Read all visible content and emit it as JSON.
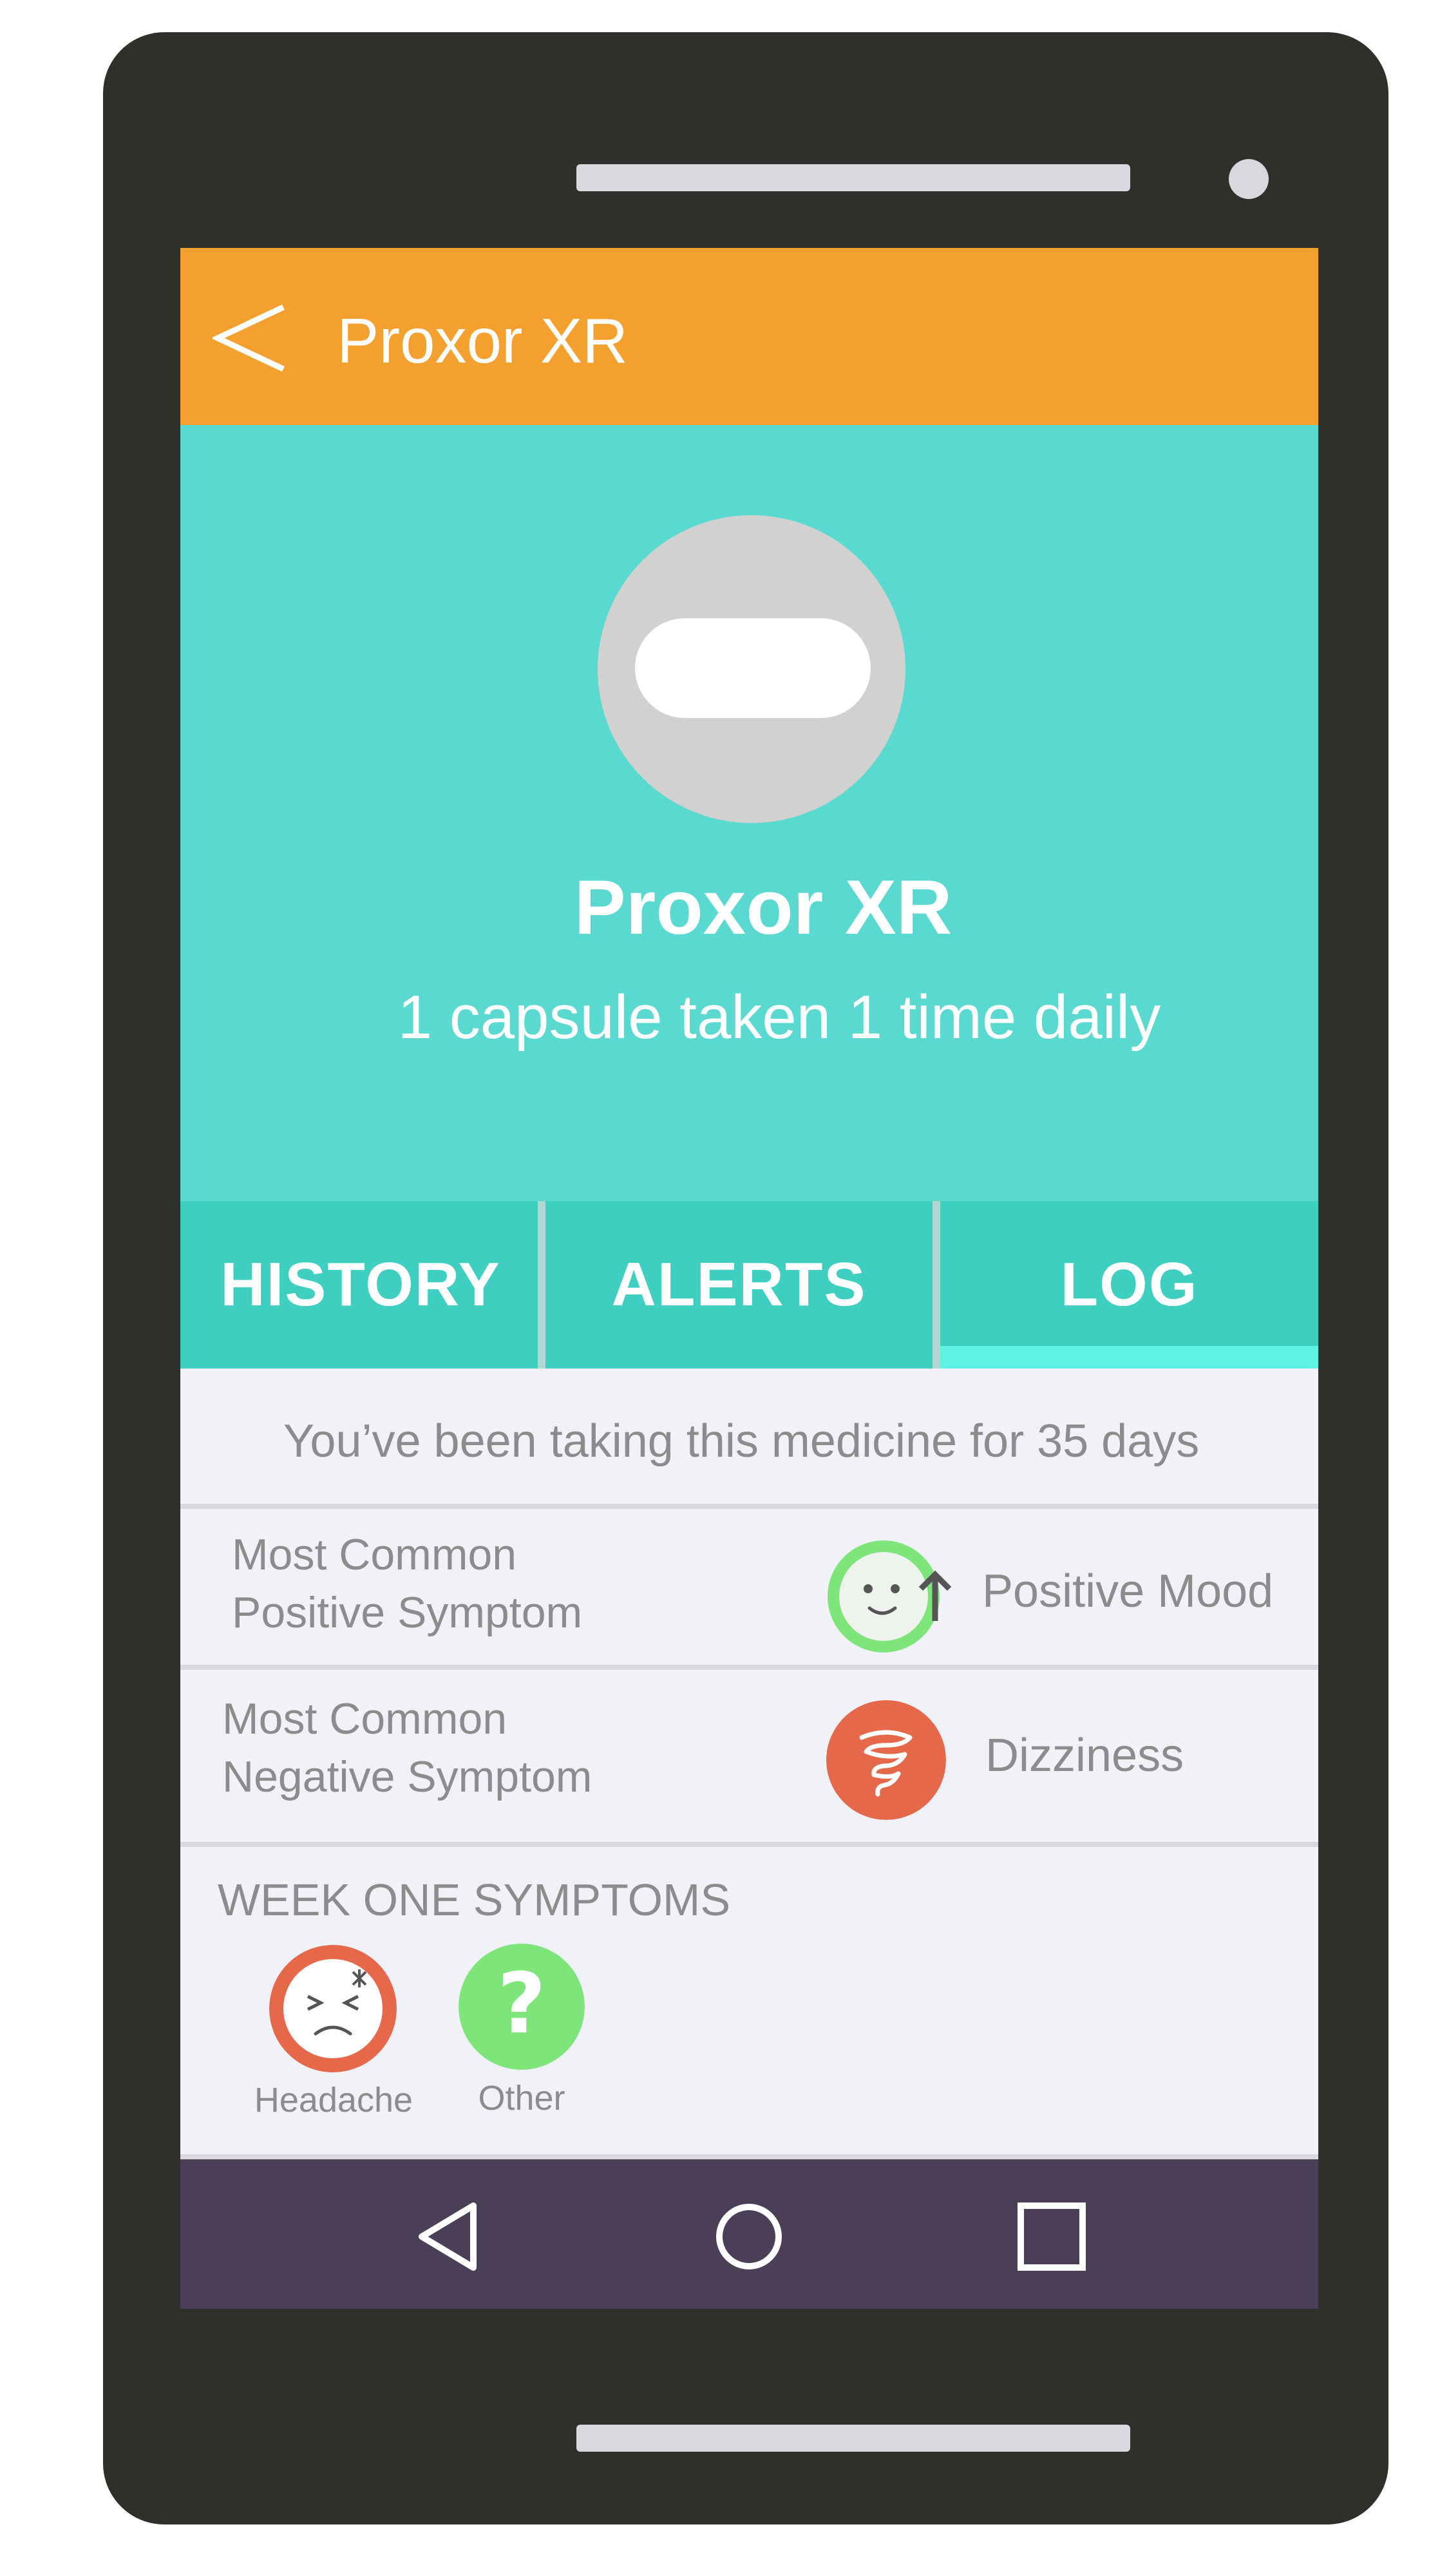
{
  "app": {
    "title": "Proxor XR"
  },
  "hero": {
    "name": "Proxor XR",
    "dose": "1 capsule taken 1 time daily"
  },
  "tabs": [
    {
      "label": "HISTORY",
      "active": false
    },
    {
      "label": "ALERTS",
      "active": false
    },
    {
      "label": "LOG",
      "active": true
    }
  ],
  "log": {
    "duration_text": "You’ve been taking this medicine for 35 days",
    "positive": {
      "label_line1": "Most Common",
      "label_line2": "Positive Symptom",
      "symptom": "Positive Mood",
      "icon": "smiley-mood-up-icon"
    },
    "negative": {
      "label_line1": "Most Common",
      "label_line2": "Negative Symptom",
      "symptom": "Dizziness",
      "icon": "dizziness-swirl-icon"
    },
    "week_one": {
      "heading": "WEEK ONE SYMPTOMS",
      "items": [
        {
          "label": "Headache",
          "icon": "headache-face-icon"
        },
        {
          "label": "Other",
          "icon": "question-mark-icon"
        }
      ]
    }
  },
  "colors": {
    "app_bar": "#f4a02e",
    "hero": "#5ad9d1",
    "tabs": "#3ecfc0",
    "tab_indicator": "#5ef2e4",
    "positive": "#7ee57a",
    "negative": "#e5684a",
    "nav_bar": "#4a3f56",
    "phone_body": "#2e302c"
  },
  "nav": {
    "icons": [
      "back-triangle-icon",
      "home-circle-icon",
      "recents-square-icon"
    ]
  }
}
